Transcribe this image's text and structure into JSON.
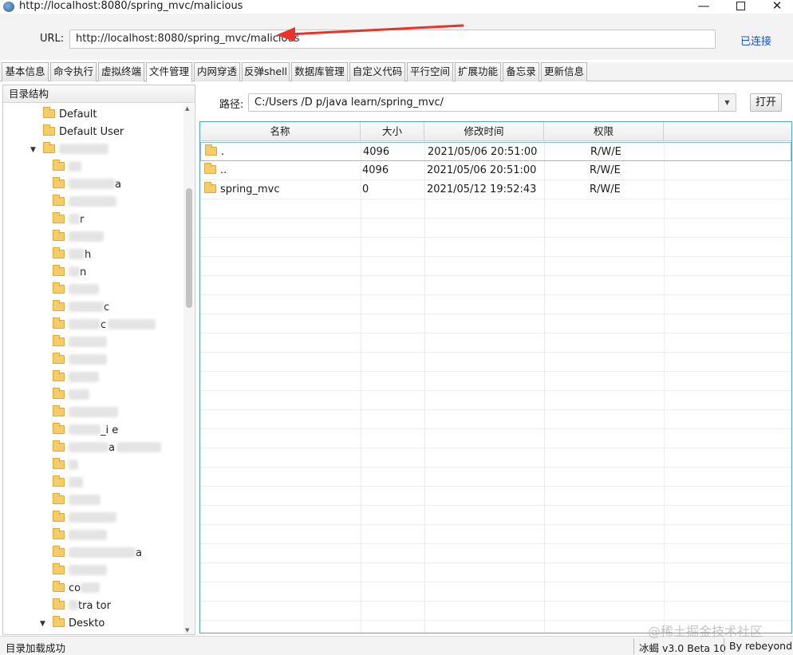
{
  "window": {
    "title": "http://localhost:8080/spring_mvc/malicious"
  },
  "url_bar": {
    "label": "URL:",
    "value": "http://localhost:8080/spring_mvc/malicious",
    "status": "已连接"
  },
  "tabs": [
    {
      "label": "基本信息"
    },
    {
      "label": "命令执行"
    },
    {
      "label": "虚拟终端"
    },
    {
      "label": "文件管理",
      "active": true
    },
    {
      "label": "内网穿透"
    },
    {
      "label": "反弹shell"
    },
    {
      "label": "数据库管理"
    },
    {
      "label": "自定义代码"
    },
    {
      "label": "平行空间"
    },
    {
      "label": "扩展功能"
    },
    {
      "label": "备忘录"
    },
    {
      "label": "更新信息"
    }
  ],
  "sidebar": {
    "header": "目录结构",
    "tree": [
      {
        "label": "Default"
      },
      {
        "label": "Default User"
      },
      {
        "label": "",
        "blurred": true
      },
      {
        "label": "",
        "blurred": true
      },
      {
        "label": "a",
        "blurred": true
      },
      {
        "label": "",
        "blurred": true
      },
      {
        "label": "r",
        "blurred": true
      },
      {
        "label": "",
        "blurred": true
      },
      {
        "label": "h",
        "blurred": true
      },
      {
        "label": "n",
        "blurred": true
      },
      {
        "label": "",
        "blurred": true
      },
      {
        "label": "c",
        "blurred": true
      },
      {
        "label": "c",
        "blurred": true
      },
      {
        "label": "",
        "blurred": true
      },
      {
        "label": "",
        "blurred": true
      },
      {
        "label": "",
        "blurred": true
      },
      {
        "label": "",
        "blurred": true
      },
      {
        "label": "",
        "blurred": true
      },
      {
        "label": "_i e",
        "blurred": true
      },
      {
        "label": "a",
        "blurred": true
      },
      {
        "label": "",
        "blurred": true
      },
      {
        "label": "",
        "blurred": true
      },
      {
        "label": "",
        "blurred": true
      },
      {
        "label": "",
        "blurred": true
      },
      {
        "label": "",
        "blurred": true
      },
      {
        "label": "a",
        "blurred": true
      },
      {
        "label": "",
        "blurred": true
      },
      {
        "label": "co",
        "blurred": true
      },
      {
        "label": "tra tor",
        "blurred": true
      },
      {
        "label": "Deskto",
        "blurred": true
      }
    ]
  },
  "path_bar": {
    "label": "路径:",
    "value": "C:/Users          /D          p/java learn/spring_mvc/",
    "open_button": "打开"
  },
  "file_table": {
    "columns": [
      "名称",
      "大小",
      "修改时间",
      "权限"
    ],
    "rows": [
      {
        "name": ".",
        "size": "4096",
        "modified": "2021/05/06 20:51:00",
        "perm": "R/W/E"
      },
      {
        "name": "..",
        "size": "4096",
        "modified": "2021/05/06 20:51:00",
        "perm": "R/W/E"
      },
      {
        "name": "spring_mvc",
        "size": "0",
        "modified": "2021/05/12 19:52:43",
        "perm": "R/W/E"
      }
    ]
  },
  "status_bar": {
    "left": "目录加载成功",
    "version": "冰蝎 v3.0 Beta 10",
    "author": "By rebeyond"
  },
  "watermark": "@稀土掘金技术社区",
  "colors": {
    "link_blue": "#1b4fcf",
    "arrow_red": "#e8332a",
    "table_border": "#4aa3d8"
  }
}
